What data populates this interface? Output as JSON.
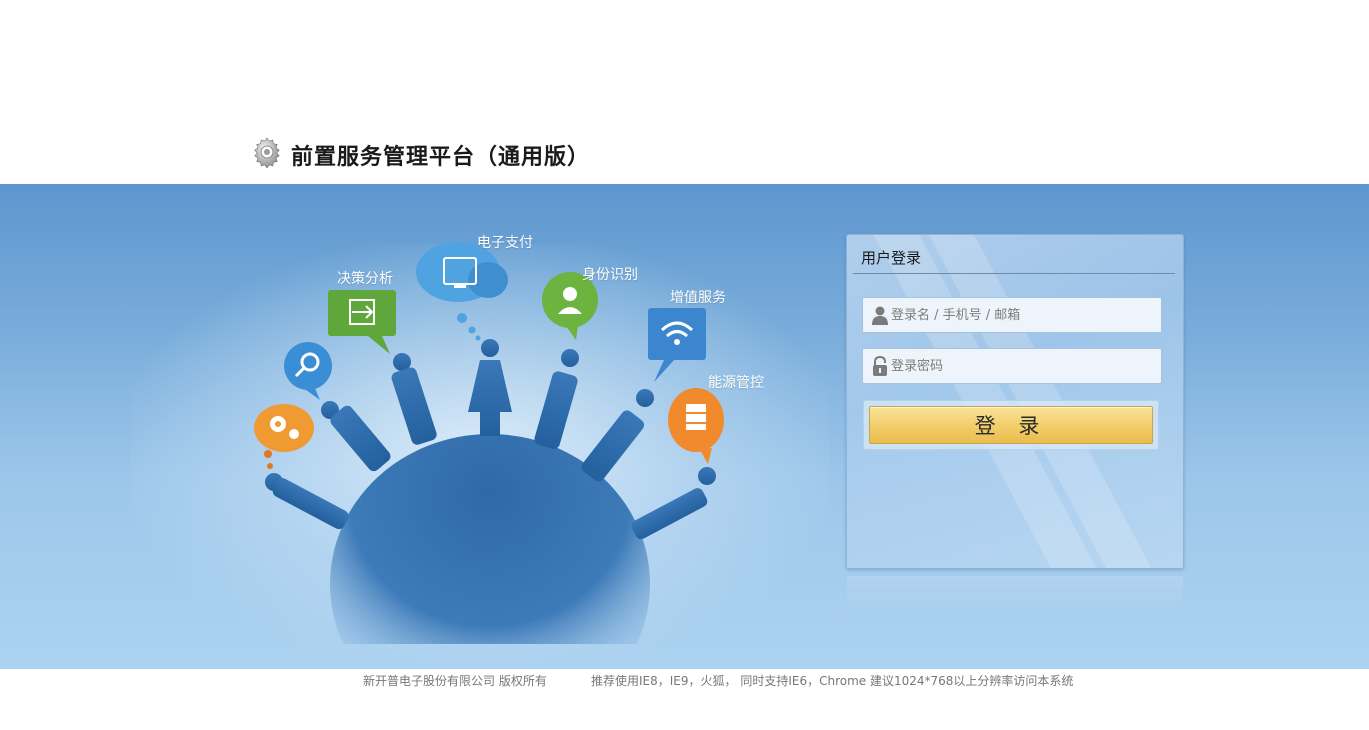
{
  "header": {
    "title": "前置服务管理平台（通用版）",
    "logo_icon": "gear-icon"
  },
  "illustration": {
    "labels": {
      "payment": "电子支付",
      "decision": "决策分析",
      "identity": "身份识别",
      "value_added": "增值服务",
      "energy": "能源管控"
    },
    "icons": [
      "gear-icon",
      "search-icon",
      "arrows-icon",
      "cart-icon",
      "person-icon",
      "wifi-icon",
      "server-icon"
    ]
  },
  "login": {
    "title": "用户登录",
    "username_placeholder": "登录名 / 手机号 / 邮箱",
    "username_value": "",
    "password_placeholder": "登录密码",
    "password_value": "",
    "submit_label": "登 录"
  },
  "footer": {
    "copyright": "新开普电子股份有限公司 版权所有",
    "browser_tip": "推荐使用IE8，IE9，火狐，  同时支持IE6，Chrome   建议1024*768以上分辨率访问本系统"
  },
  "colors": {
    "banner_top": "#5d97cf",
    "banner_bottom": "#acd2f0",
    "button_gold": "#f3cf6b",
    "figure_blue": "#2e6fb0"
  }
}
